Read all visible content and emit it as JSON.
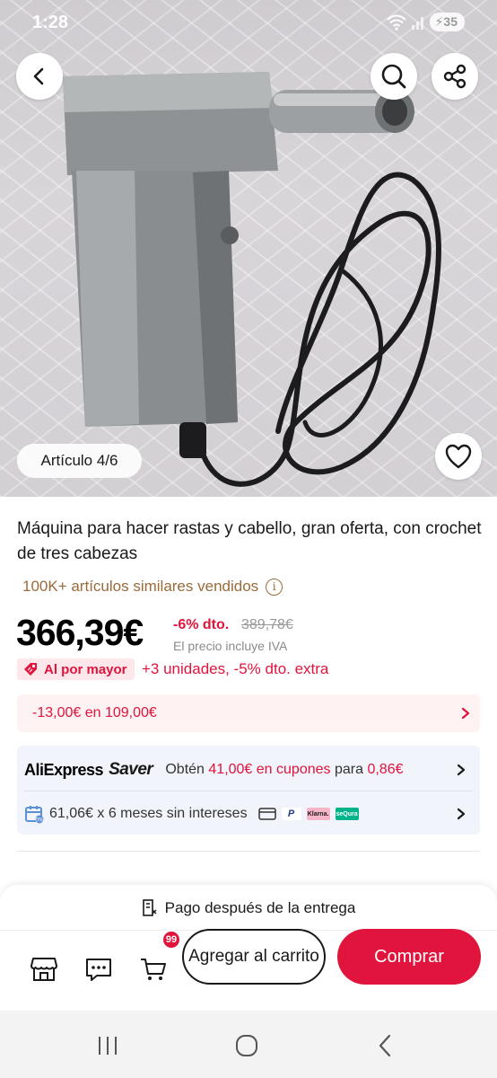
{
  "status": {
    "time": "1:28",
    "battery": "35"
  },
  "gallery": {
    "article_label": "Artículo 4/6"
  },
  "product": {
    "title": "Máquina para hacer rastas y cabello, gran oferta, con crochet de tres cabezas",
    "sold": "100K+ artículos similares vendidos",
    "price": "366,39€",
    "discount": "-6% dto.",
    "original_price": "389,78€",
    "iva_note": "El precio incluye IVA",
    "wholesale_label": "Al por mayor",
    "wholesale_offer": "+3 unidades, -5% dto. extra"
  },
  "coupon": {
    "text": "-13,00€ en 109,00€"
  },
  "saver": {
    "brand": "AliExpress",
    "brand_suffix": "Saver",
    "text_prefix": "Obtén",
    "coupon_amount": "41,00€ en cupones",
    "text_mid": "para",
    "price": "0,86€"
  },
  "installments": {
    "text": "61,06€ x 6 meses sin intereses",
    "methods": [
      "card-icon",
      "paypal-icon",
      "klarna-icon",
      "sequra-icon"
    ],
    "klarna": "Klarna.",
    "sequra": "seQura"
  },
  "bottom": {
    "pay_after": "Pago después de la entrega",
    "cart_count": "99",
    "add_to_cart": "Agregar al carrito",
    "buy": "Comprar"
  },
  "colors": {
    "accent": "#e0143c",
    "sold_text": "#9a6a3a"
  }
}
